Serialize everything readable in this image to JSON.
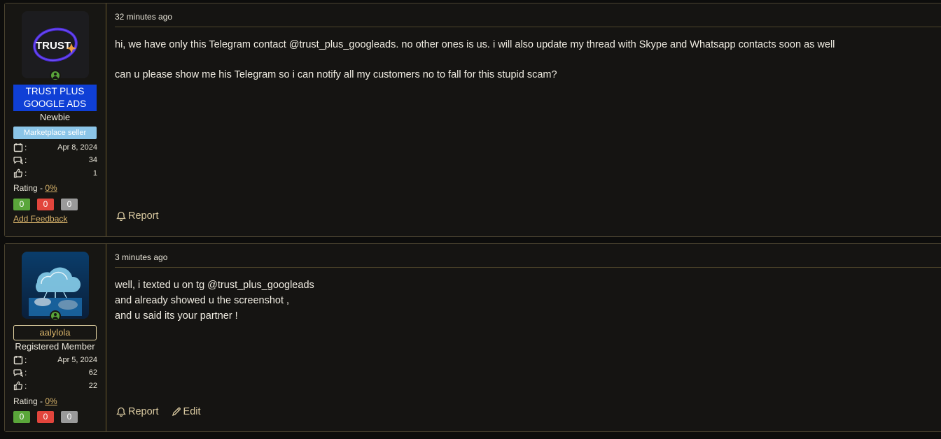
{
  "posts": [
    {
      "avatar_text": "TRUST",
      "username": "TRUST PLUS GOOGLE ADS",
      "user_title": "Newbie",
      "badge": "Marketplace seller",
      "stats": {
        "joined": "Apr 8, 2024",
        "messages": "34",
        "reactions": "1"
      },
      "rating_label": "Rating - ",
      "rating_value": "0%",
      "feedback": {
        "positive": "0",
        "negative": "0",
        "neutral": "0"
      },
      "add_feedback": "Add Feedback",
      "time": "32 minutes ago",
      "lines": [
        "hi, we have only this Telegram contact @trust_plus_googleads. no other ones is us. i will also update my thread with Skype and Whatsapp contacts soon as well",
        "can u please show me his Telegram so i can notify all my customers no to fall for this stupid scam?"
      ],
      "actions": {
        "report": "Report"
      }
    },
    {
      "username": "aalylola",
      "user_title": "Registered Member",
      "stats": {
        "joined": "Apr 5, 2024",
        "messages": "62",
        "reactions": "22"
      },
      "rating_label": "Rating - ",
      "rating_value": "0%",
      "feedback": {
        "positive": "0",
        "negative": "0",
        "neutral": "0"
      },
      "time": "3 minutes ago",
      "lines": [
        "well, i texted u on tg @trust_plus_googleads",
        "and already showed u the screenshot ,",
        "and u said its your partner !"
      ],
      "actions": {
        "report": "Report",
        "edit": "Edit"
      }
    }
  ],
  "colors": {
    "accent": "#d9b46b",
    "username_blue": "#0f3fd6",
    "seller_badge": "#8bc5e8",
    "positive": "#5aa63a",
    "negative": "#e2453c",
    "neutral": "#9a9a9a",
    "online": "#58a33a"
  },
  "icons": {
    "joined": "calendar-icon",
    "messages": "messages-icon",
    "reactions": "thumbs-up-icon",
    "report": "bell-icon",
    "edit": "pencil-icon",
    "online": "online-user-icon"
  }
}
